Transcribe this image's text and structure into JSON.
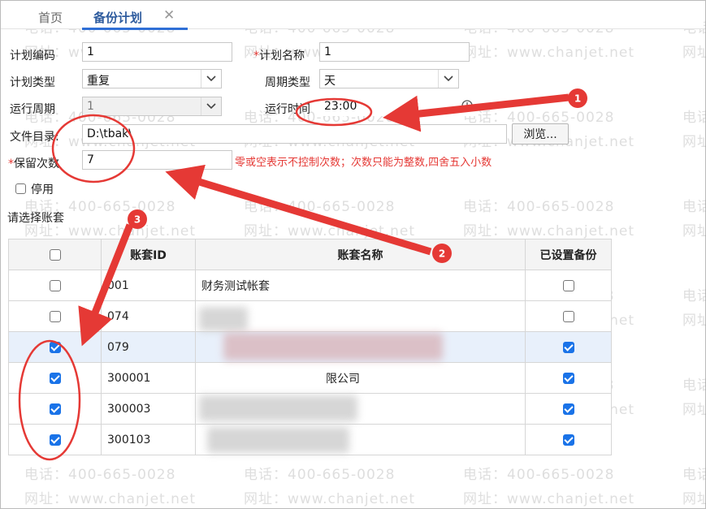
{
  "tabs": [
    {
      "label": "首页"
    },
    {
      "label": "备份计划"
    }
  ],
  "tab_close": "✕",
  "form": {
    "plan_code_label": "计划编码",
    "plan_code_value": "1",
    "plan_name_label": "计划名称",
    "plan_name_value": "1",
    "plan_type_label": "计划类型",
    "plan_type_value": "重复",
    "cycle_type_label": "周期类型",
    "cycle_type_value": "天",
    "run_cycle_label": "运行周期",
    "run_cycle_value": "1",
    "run_time_label": "运行时间",
    "run_time_value": "23:00",
    "file_dir_label": "文件目录:",
    "file_dir_value": "D:\\tbak\\",
    "browse_label": "浏览...",
    "keep_count_label": "保留次数",
    "keep_count_value": "7",
    "keep_count_hint": "零或空表示不控制次数；次数只能为整数,四舍五入小数",
    "required_mark": "*",
    "disable_label": "停用",
    "disable_checked": false
  },
  "accounts": {
    "section_label": "请选择账套",
    "columns": [
      "账套ID",
      "账套名称",
      "已设置备份"
    ],
    "header_checked": false,
    "rows": [
      {
        "checked": false,
        "id": "001",
        "name": "财务测试帐套",
        "backup": false,
        "highlight": false
      },
      {
        "checked": false,
        "id": "074",
        "name": "",
        "backup": false,
        "highlight": false
      },
      {
        "checked": true,
        "id": "079",
        "name": "",
        "backup": true,
        "highlight": true
      },
      {
        "checked": true,
        "id": "300001",
        "name": "限公司",
        "backup": true,
        "highlight": false
      },
      {
        "checked": true,
        "id": "300003",
        "name": "",
        "backup": true,
        "highlight": false
      },
      {
        "checked": true,
        "id": "300103",
        "name": "",
        "backup": true,
        "highlight": false
      }
    ]
  },
  "annotations": {
    "badges": [
      "1",
      "2",
      "3"
    ],
    "color": "#e53935"
  },
  "watermark": {
    "phone": "电话：400-665-0028",
    "site": "网址：www.chanjet.net"
  },
  "icons": {
    "select_arrow": "chevron-down-icon",
    "time_picker": "clock-icon",
    "tab_close": "close-icon"
  }
}
